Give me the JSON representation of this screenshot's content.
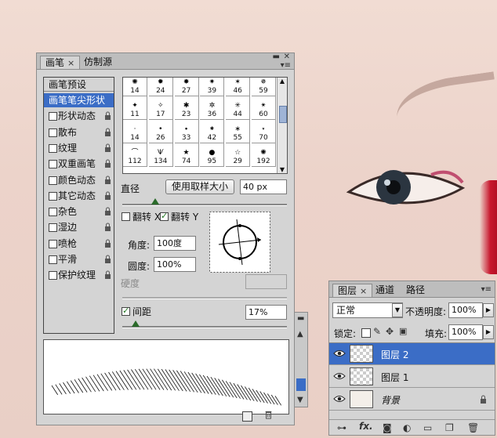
{
  "brush_panel": {
    "tabs": [
      {
        "label": "画笔",
        "active": true
      },
      {
        "label": "仿制源",
        "active": false
      }
    ],
    "menu_icon": "panel-menu-icon",
    "presets_header": "画笔预设",
    "options": [
      {
        "label": "画笔笔尖形状",
        "selected": true,
        "has_checkbox": false,
        "checked": false,
        "lock": false
      },
      {
        "label": "形状动态",
        "selected": false,
        "has_checkbox": true,
        "checked": false,
        "lock": true
      },
      {
        "label": "散布",
        "selected": false,
        "has_checkbox": true,
        "checked": false,
        "lock": true
      },
      {
        "label": "纹理",
        "selected": false,
        "has_checkbox": true,
        "checked": false,
        "lock": true
      },
      {
        "label": "双重画笔",
        "selected": false,
        "has_checkbox": true,
        "checked": false,
        "lock": true
      },
      {
        "label": "颜色动态",
        "selected": false,
        "has_checkbox": true,
        "checked": false,
        "lock": true
      },
      {
        "label": "其它动态",
        "selected": false,
        "has_checkbox": true,
        "checked": false,
        "lock": true
      },
      {
        "label": "杂色",
        "selected": false,
        "has_checkbox": true,
        "checked": false,
        "lock": true
      },
      {
        "label": "湿边",
        "selected": false,
        "has_checkbox": true,
        "checked": false,
        "lock": true
      },
      {
        "label": "喷枪",
        "selected": false,
        "has_checkbox": true,
        "checked": false,
        "lock": true
      },
      {
        "label": "平滑",
        "selected": false,
        "has_checkbox": true,
        "checked": false,
        "lock": true
      },
      {
        "label": "保护纹理",
        "selected": false,
        "has_checkbox": true,
        "checked": false,
        "lock": true
      }
    ],
    "brush_sizes": [
      "14",
      "24",
      "27",
      "39",
      "46",
      "59",
      "11",
      "17",
      "23",
      "36",
      "44",
      "60",
      "14",
      "26",
      "33",
      "42",
      "55",
      "70",
      "112",
      "134",
      "74",
      "95",
      "29",
      "192"
    ],
    "diameter_label": "直径",
    "use_sample_size_label": "使用取样大小",
    "diameter_value": "40 px",
    "diameter_slider_fraction": 0.2,
    "flip_x_label": "翻转 X",
    "flip_x_checked": false,
    "flip_y_label": "翻转 Y",
    "flip_y_checked": true,
    "angle_label": "角度:",
    "angle_value": "100度",
    "roundness_label": "圆度:",
    "roundness_value": "100%",
    "hardness_label": "硬度",
    "spacing_label": "间距",
    "spacing_checked": true,
    "spacing_value": "17%",
    "spacing_slider_fraction": 0.08
  },
  "layers_panel": {
    "tabs": [
      {
        "label": "图层",
        "active": true
      },
      {
        "label": "通道",
        "active": false
      },
      {
        "label": "路径",
        "active": false
      }
    ],
    "blend_mode": "正常",
    "opacity_label": "不透明度:",
    "opacity_value": "100%",
    "lock_label": "锁定:",
    "fill_label": "填充:",
    "fill_value": "100%",
    "layers": [
      {
        "name": "图层 2",
        "selected": true,
        "locked": false,
        "kind": "transparent"
      },
      {
        "name": "图层 1",
        "selected": false,
        "locked": false,
        "kind": "transparent"
      },
      {
        "name": "背景",
        "selected": false,
        "locked": true,
        "kind": "photo"
      }
    ]
  },
  "colors": {
    "selection": "#3b6dc6",
    "panel": "#d4d4d4",
    "skin": "#ecd3ca",
    "red_edge": "#c8182e"
  }
}
